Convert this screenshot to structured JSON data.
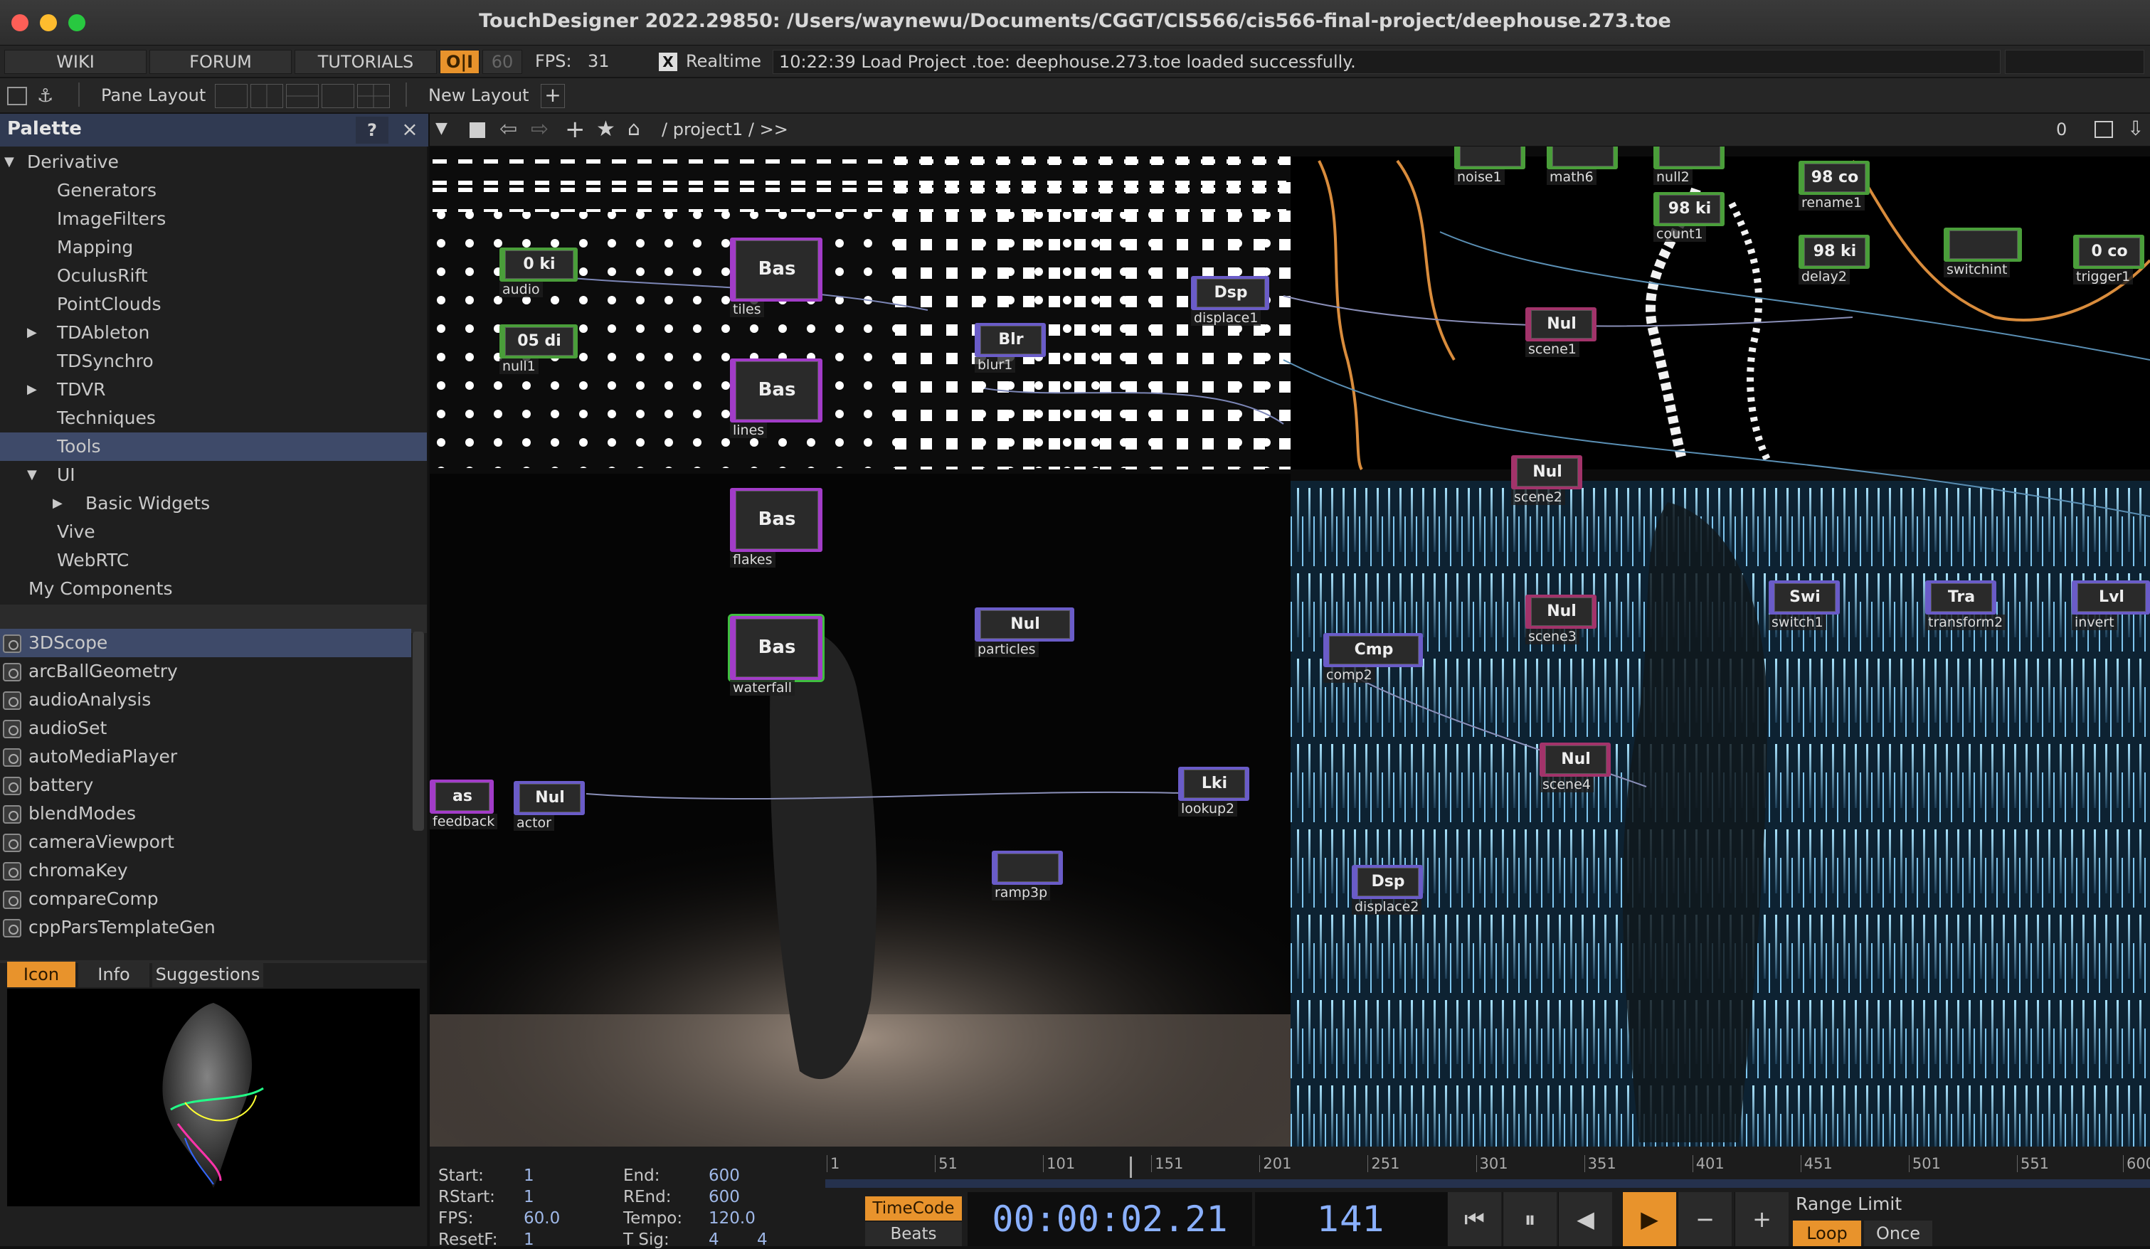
{
  "window": {
    "title": "TouchDesigner 2022.29850: /Users/waynewu/Documents/CGGT/CIS566/cis566-final-project/deephouse.273.toe"
  },
  "menubar": {
    "wiki": "WIKI",
    "forum": "FORUM",
    "tutorials": "TUTORIALS",
    "oi": "O|I",
    "fps_target": "60",
    "fps_label": "FPS:",
    "fps_value": "31",
    "realtime_check": "X",
    "realtime_label": "Realtime",
    "status": "10:22:39 Load Project .toe: deephouse.273.toe loaded successfully."
  },
  "toolbar": {
    "pane_layout": "Pane Layout",
    "new_layout": "New Layout",
    "add": "+"
  },
  "palette": {
    "title": "Palette",
    "help": "?",
    "close": "×",
    "tree": [
      {
        "label": "Derivative",
        "arrow": "▼",
        "indent": 0
      },
      {
        "label": "Generators",
        "arrow": "",
        "indent": 2
      },
      {
        "label": "ImageFilters",
        "arrow": "",
        "indent": 2
      },
      {
        "label": "Mapping",
        "arrow": "",
        "indent": 2
      },
      {
        "label": "OculusRift",
        "arrow": "",
        "indent": 2
      },
      {
        "label": "PointClouds",
        "arrow": "",
        "indent": 2
      },
      {
        "label": "TDAbleton",
        "arrow": "▶",
        "indent": 2
      },
      {
        "label": "TDSynchro",
        "arrow": "",
        "indent": 2
      },
      {
        "label": "TDVR",
        "arrow": "▶",
        "indent": 2
      },
      {
        "label": "Techniques",
        "arrow": "",
        "indent": 2
      },
      {
        "label": "Tools",
        "arrow": "",
        "indent": 2,
        "selected": true
      },
      {
        "label": "UI",
        "arrow": "▼",
        "indent": 2
      },
      {
        "label": "Basic Widgets",
        "arrow": "▶",
        "indent": 3
      },
      {
        "label": "Vive",
        "arrow": "",
        "indent": 2
      },
      {
        "label": "WebRTC",
        "arrow": "",
        "indent": 2
      },
      {
        "label": "My Components",
        "arrow": "",
        "indent": 1
      }
    ],
    "components": [
      "3DScope",
      "arcBallGeometry",
      "audioAnalysis",
      "audioSet",
      "autoMediaPlayer",
      "battery",
      "blendModes",
      "cameraViewport",
      "chromaKey",
      "compareComp",
      "cppParsTemplateGen"
    ],
    "tabs": [
      "Icon",
      "Info",
      "Suggestions"
    ]
  },
  "network": {
    "path": "/ project1 / >>",
    "right_count": "0",
    "nodes": [
      {
        "name": "audio",
        "type": "0 ki"
      },
      {
        "name": "null1",
        "type": "05 di"
      },
      {
        "name": "tiles",
        "type": "Bas"
      },
      {
        "name": "lines",
        "type": "Bas"
      },
      {
        "name": "flakes",
        "type": "Bas"
      },
      {
        "name": "waterfall",
        "type": "Bas"
      },
      {
        "name": "blur1",
        "type": "Blr"
      },
      {
        "name": "particles",
        "type": "Nul"
      },
      {
        "name": "displace1",
        "type": "Dsp"
      },
      {
        "name": "scene1",
        "type": "Nul"
      },
      {
        "name": "scene2",
        "type": "Nul"
      },
      {
        "name": "scene3",
        "type": "Nul"
      },
      {
        "name": "comp2",
        "type": "Cmp"
      },
      {
        "name": "count1",
        "type": "98 ki"
      },
      {
        "name": "rename1",
        "type": "98 co"
      },
      {
        "name": "delay2",
        "type": "98 ki"
      },
      {
        "name": "switchint",
        "type": ""
      },
      {
        "name": "trigger1",
        "type": "0 co"
      },
      {
        "name": "switch1",
        "type": "Swi"
      },
      {
        "name": "transform2",
        "type": "Tra"
      },
      {
        "name": "invert",
        "type": "Lvl"
      },
      {
        "name": "noise1",
        "type": ""
      },
      {
        "name": "math6",
        "type": ""
      },
      {
        "name": "null2",
        "type": ""
      },
      {
        "name": "feedback",
        "type": "as"
      },
      {
        "name": "actor",
        "type": "Nul"
      },
      {
        "name": "lookup2",
        "type": "Lki"
      },
      {
        "name": "ramp3p",
        "type": ""
      },
      {
        "name": "scene4",
        "type": "Nul"
      },
      {
        "name": "displace2",
        "type": "Dsp"
      }
    ]
  },
  "timeline": {
    "start_label": "Start:",
    "start": "1",
    "rstart_label": "RStart:",
    "rstart": "1",
    "fps_label": "FPS:",
    "fps": "60.0",
    "resetf_label": "ResetF:",
    "resetf": "1",
    "end_label": "End:",
    "end": "600",
    "rend_label": "REnd:",
    "rend": "600",
    "tempo_label": "Tempo:",
    "tempo": "120.0",
    "tsig_label": "T Sig:",
    "tsig_a": "4",
    "tsig_b": "4",
    "ticks": [
      "1",
      "51",
      "101",
      "151",
      "201",
      "251",
      "301",
      "351",
      "401",
      "451",
      "501",
      "551",
      "600"
    ],
    "playhead_frame": 141,
    "timecode_btn": "TimeCode",
    "beats_btn": "Beats",
    "timecode": "00:00:02.21",
    "frame": "141",
    "range_limit": "Range Limit",
    "loop": "Loop",
    "once": "Once",
    "colors": {
      "accent": "#e8932c",
      "selection": "#3e4a69",
      "timecode": "#8ab0ff"
    }
  }
}
